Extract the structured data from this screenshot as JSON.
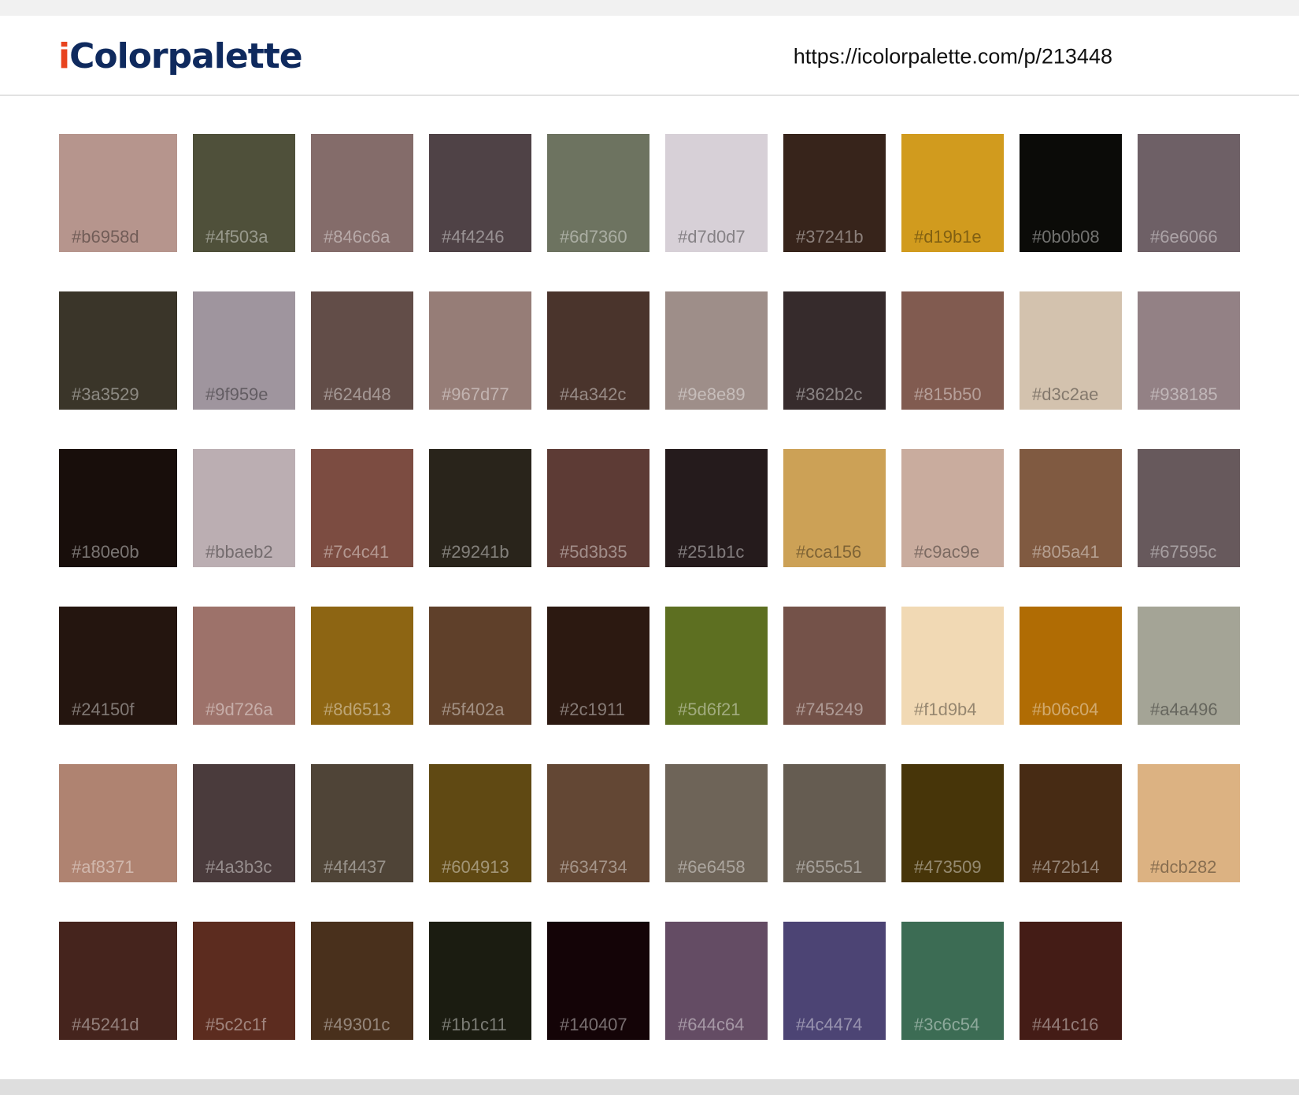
{
  "header": {
    "logo_accent": "i",
    "logo_rest": "Colorpalette",
    "url": "https://icolorpalette.com/p/213448"
  },
  "colors": {
    "logo": "#0f2a5e",
    "logo_accent": "#e8431e"
  },
  "swatches": [
    [
      "#b6958d",
      "#4f503a",
      "#846c6a",
      "#4f4246",
      "#6d7360",
      "#d7d0d7",
      "#37241b",
      "#d19b1e",
      "#0b0b08",
      "#6e6066"
    ],
    [
      "#3a3529",
      "#9f959e",
      "#624d48",
      "#967d77",
      "#4a342c",
      "#9e8e89",
      "#362b2c",
      "#815b50",
      "#d3c2ae",
      "#938185"
    ],
    [
      "#180e0b",
      "#bbaeb2",
      "#7c4c41",
      "#29241b",
      "#5d3b35",
      "#251b1c",
      "#cca156",
      "#c9ac9e",
      "#805a41",
      "#67595c"
    ],
    [
      "#24150f",
      "#9d726a",
      "#8d6513",
      "#5f402a",
      "#2c1911",
      "#5d6f21",
      "#745249",
      "#f1d9b4",
      "#b06c04",
      "#a4a496"
    ],
    [
      "#af8371",
      "#4a3b3c",
      "#4f4437",
      "#604913",
      "#634734",
      "#6e6458",
      "#655c51",
      "#473509",
      "#472b14",
      "#dcb282"
    ],
    [
      "#45241d",
      "#5c2c1f",
      "#49301c",
      "#1b1c11",
      "#140407",
      "#644c64",
      "#4c4474",
      "#3c6c54",
      "#441c16"
    ]
  ]
}
